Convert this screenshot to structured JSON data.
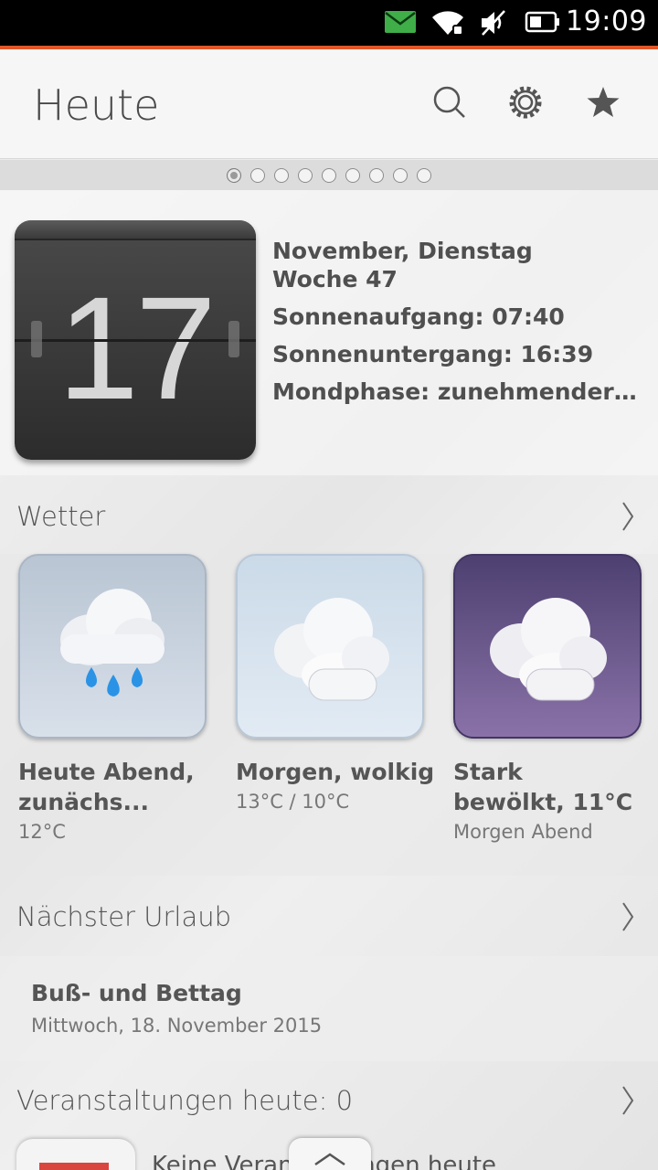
{
  "status_bar": {
    "time": "19:09",
    "icons": [
      "mail-icon",
      "wifi-icon",
      "mute-icon",
      "battery-icon"
    ],
    "accent_color": "#e2572a"
  },
  "header": {
    "title": "Heute",
    "actions": [
      "search-icon",
      "gear-icon",
      "star-icon"
    ]
  },
  "pager": {
    "count": 9,
    "active_index": 0
  },
  "day": {
    "number": "17",
    "lines": [
      "November, Dienstag",
      "Woche 47",
      "Sonnenaufgang: 07:40",
      "Sonnenuntergang: 16:39",
      "Mondphase: zunehmender …"
    ]
  },
  "weather": {
    "heading": "Wetter",
    "tiles": [
      {
        "icon": "rain-cloud-icon",
        "title": "Heute Abend, zunächs...",
        "sub": "12°C",
        "bg": "#c6d0dc"
      },
      {
        "icon": "cloudy-icon",
        "title": "Morgen, wolkig",
        "sub": "13°C / 10°C",
        "bg": "#d3e0ec"
      },
      {
        "icon": "overcast-night-icon",
        "title": "Stark bewölkt, 11°C",
        "sub": "Morgen Abend",
        "bg": "#5a4a80"
      }
    ]
  },
  "holiday": {
    "heading": "Nächster Urlaub",
    "name": "Buß- und Bettag",
    "date": "Mittwoch, 18. November 2015"
  },
  "events": {
    "heading": "Veranstaltungen heute: 0",
    "empty_text": "Keine Veranstaltungen heute"
  },
  "bottom_edge": {
    "icon": "chevron-up-icon"
  }
}
